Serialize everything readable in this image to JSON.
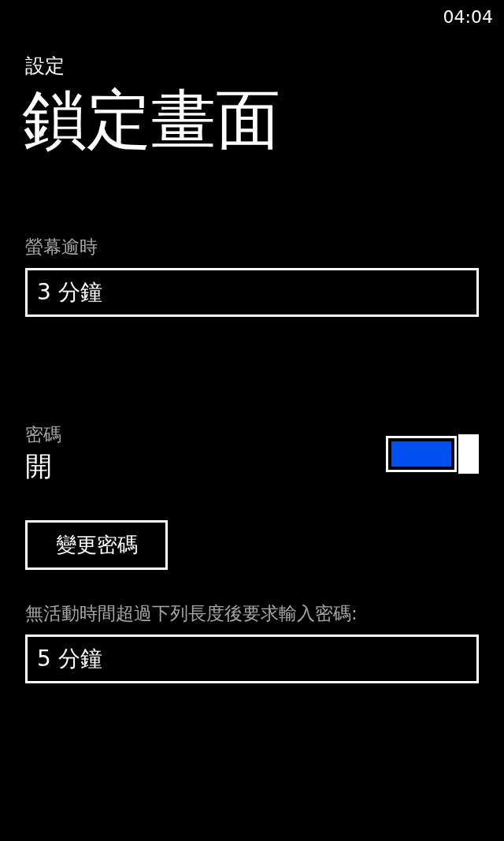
{
  "status_bar": {
    "time": "04:04"
  },
  "header": {
    "app": "設定",
    "title": "鎖定畫面"
  },
  "screen_timeout": {
    "label": "螢幕逾時",
    "value": "3 分鐘"
  },
  "password": {
    "label": "密碼",
    "state_text": "開",
    "on": true
  },
  "change_password_button": "變更密碼",
  "require_password": {
    "label": "無活動時間超過下列長度後要求輸入密碼:",
    "value": "5 分鐘"
  }
}
